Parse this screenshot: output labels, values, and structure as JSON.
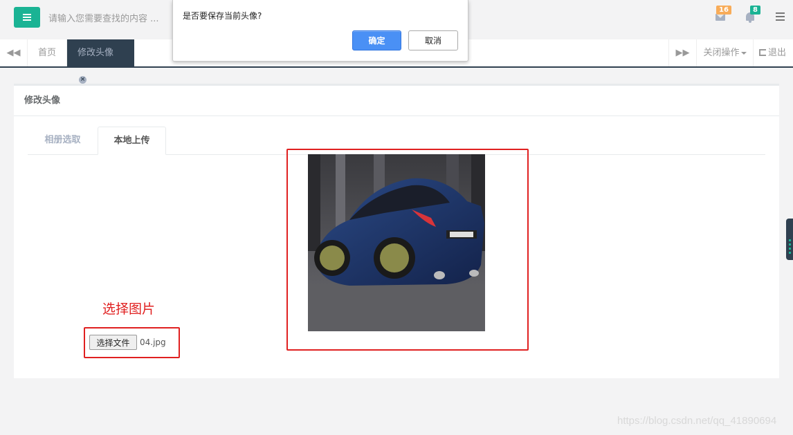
{
  "header": {
    "search_placeholder": "请输入您需要查找的内容 ...",
    "mail_count": "16",
    "notification_count": "8",
    "colors": {
      "accent": "#1ab394",
      "mail_badge": "#f8ac59",
      "dark": "#2f4050"
    }
  },
  "tabs_bar": {
    "home_label": "首页",
    "active_label": "修改头像",
    "close_ops_label": "关闭操作",
    "logout_label": "退出"
  },
  "panel": {
    "title": "修改头像",
    "tab_album": "相册选取",
    "tab_local": "本地上传",
    "choose_label": "选择图片",
    "file_button": "选择文件",
    "file_name": "04.jpg"
  },
  "dialog": {
    "message": "是否要保存当前头像?",
    "ok_label": "确定",
    "cancel_label": "取消"
  },
  "watermark": "https://blog.csdn.net/qq_41890694",
  "icons": [
    "hamburger-menu-icon",
    "mail-icon",
    "bell-icon",
    "tasks-icon",
    "backward-icon",
    "forward-icon",
    "close-circle-icon",
    "logout-icon",
    "caret-down-icon"
  ]
}
